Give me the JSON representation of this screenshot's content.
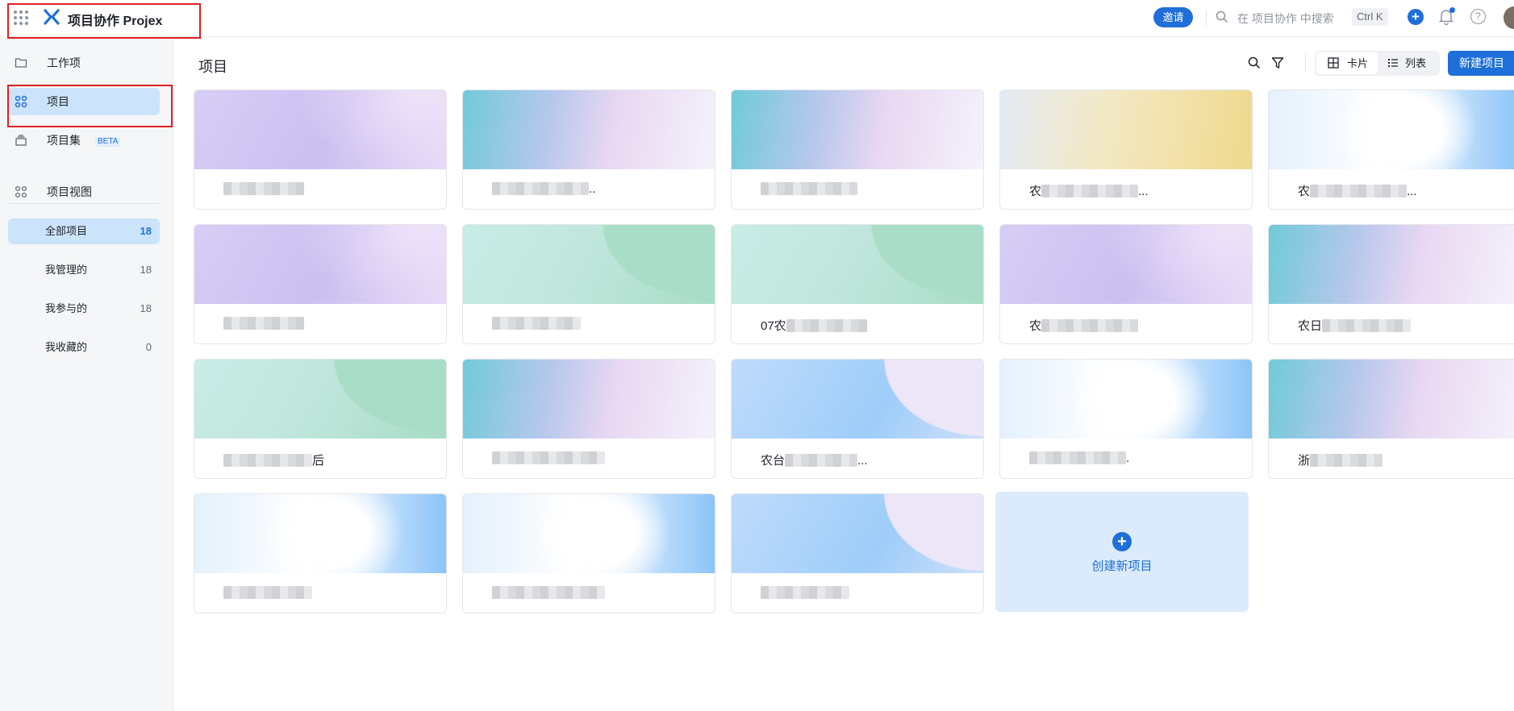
{
  "topbar": {
    "app_title": "项目协作 Projex",
    "invite_label": "邀请",
    "search_placeholder": "在 项目协作 中搜索",
    "shortcut": "Ctrl K",
    "plus_symbol": "+",
    "help_symbol": "?"
  },
  "sidebar": {
    "items": [
      {
        "label": "工作项",
        "icon": "folder-icon"
      },
      {
        "label": "项目",
        "icon": "grid-icon"
      },
      {
        "label": "项目集",
        "icon": "stack-icon",
        "badge": "BETA"
      },
      {
        "label": "项目视图",
        "icon": "views-icon"
      }
    ],
    "views": [
      {
        "label": "全部项目",
        "count": "18"
      },
      {
        "label": "我管理的",
        "count": "18"
      },
      {
        "label": "我参与的",
        "count": "18"
      },
      {
        "label": "我收藏的",
        "count": "0"
      }
    ]
  },
  "main": {
    "title": "项目",
    "view_card": "卡片",
    "view_list": "列表",
    "new_button": "新建项目",
    "create_plus": "+",
    "create_label": "创建新项目",
    "cards": [
      {
        "prefix": "",
        "suffix": "",
        "cover": "purple"
      },
      {
        "prefix": "",
        "suffix": "..",
        "cover": "teal"
      },
      {
        "prefix": "",
        "suffix": "",
        "cover": "teal"
      },
      {
        "prefix": "农",
        "suffix": "...",
        "cover": "yellow"
      },
      {
        "prefix": "农",
        "suffix": "...",
        "cover": "blue-light"
      },
      {
        "prefix": "",
        "suffix": "",
        "cover": "purple"
      },
      {
        "prefix": "",
        "suffix": "",
        "cover": "green"
      },
      {
        "prefix": "07农",
        "suffix": "",
        "cover": "green"
      },
      {
        "prefix": "农",
        "suffix": "",
        "cover": "purple"
      },
      {
        "prefix": "农日",
        "suffix": "",
        "cover": "teal"
      },
      {
        "prefix": "",
        "suffix": "后",
        "cover": "green"
      },
      {
        "prefix": "",
        "suffix": "",
        "cover": "teal"
      },
      {
        "prefix": "农台",
        "suffix": "...",
        "cover": "blue-wave"
      },
      {
        "prefix": "",
        "suffix": ".",
        "cover": "blue-light"
      },
      {
        "prefix": "浙",
        "suffix": "",
        "cover": "teal"
      },
      {
        "prefix": "",
        "suffix": "",
        "cover": "blue-light"
      },
      {
        "prefix": "",
        "suffix": "",
        "cover": "blue-light"
      },
      {
        "prefix": "",
        "suffix": "",
        "cover": "blue-wave"
      }
    ]
  },
  "colors": {
    "accent": "#1e6fd9",
    "active_bg": "#cbe4fb",
    "annotation": "#e02020"
  }
}
